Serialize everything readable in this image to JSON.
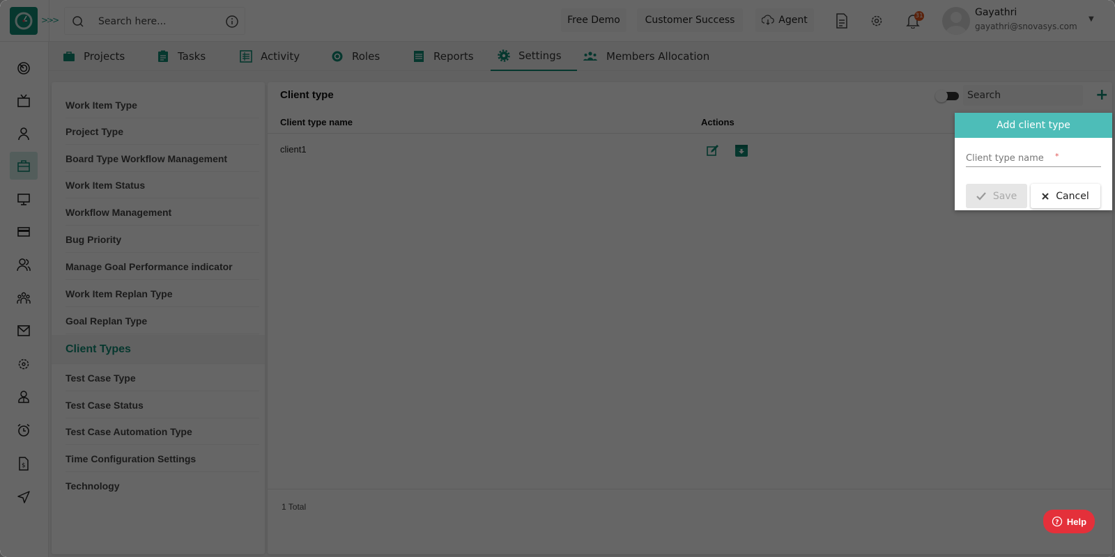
{
  "header": {
    "search_placeholder": "Search here...",
    "buttons": {
      "free_demo": "Free Demo",
      "customer_success": "Customer Success",
      "agent": "Agent"
    },
    "notification_count": "31",
    "user": {
      "name": "Gayathri",
      "email": "gayathri@snovasys.com"
    }
  },
  "rail": {
    "items": [
      {
        "icon": "dashboard-icon"
      },
      {
        "icon": "tv-icon"
      },
      {
        "icon": "user-icon"
      },
      {
        "icon": "briefcase-icon",
        "active": true
      },
      {
        "icon": "monitor-icon"
      },
      {
        "icon": "card-icon"
      },
      {
        "icon": "users-icon"
      },
      {
        "icon": "team-icon"
      },
      {
        "icon": "mail-icon"
      },
      {
        "icon": "settings-icon"
      },
      {
        "icon": "employee-icon"
      },
      {
        "icon": "alarm-icon"
      },
      {
        "icon": "document-icon"
      },
      {
        "icon": "send-icon"
      }
    ]
  },
  "tabs": [
    {
      "label": "Projects",
      "icon": "briefcase-icon"
    },
    {
      "label": "Tasks",
      "icon": "clipboard-icon"
    },
    {
      "label": "Activity",
      "icon": "list-icon"
    },
    {
      "label": "Roles",
      "icon": "roles-icon"
    },
    {
      "label": "Reports",
      "icon": "reports-icon"
    },
    {
      "label": "Settings",
      "icon": "gear-icon",
      "active": true
    },
    {
      "label": "Members Allocation",
      "icon": "members-icon"
    }
  ],
  "settings_menu": {
    "items": [
      "Work Item Type",
      "Project Type",
      "Board Type Workflow Management",
      "Work Item Status",
      "Workflow Management",
      "Bug Priority",
      "Manage Goal Performance indicator",
      "Work Item Replan Type",
      "Goal Replan Type",
      "Client Types",
      "Test Case Type",
      "Test Case Status",
      "Test Case Automation Type",
      "Time Configuration Settings",
      "Technology"
    ],
    "active": "Client Types"
  },
  "client_type": {
    "title": "Client type",
    "search_placeholder": "Search",
    "columns": [
      "Client type name",
      "Actions"
    ],
    "rows": [
      {
        "name": "client1"
      }
    ],
    "total": "1 Total"
  },
  "popup": {
    "title": "Add client type",
    "field_placeholder": "Client type name",
    "required_mark": "*",
    "save_label": "Save",
    "cancel_label": "Cancel"
  },
  "help": {
    "label": "Help"
  },
  "colors": {
    "brand": "#0f8b74",
    "popup_header": "#4dbdb8",
    "help": "#e4303a",
    "badge": "#e2541b"
  }
}
